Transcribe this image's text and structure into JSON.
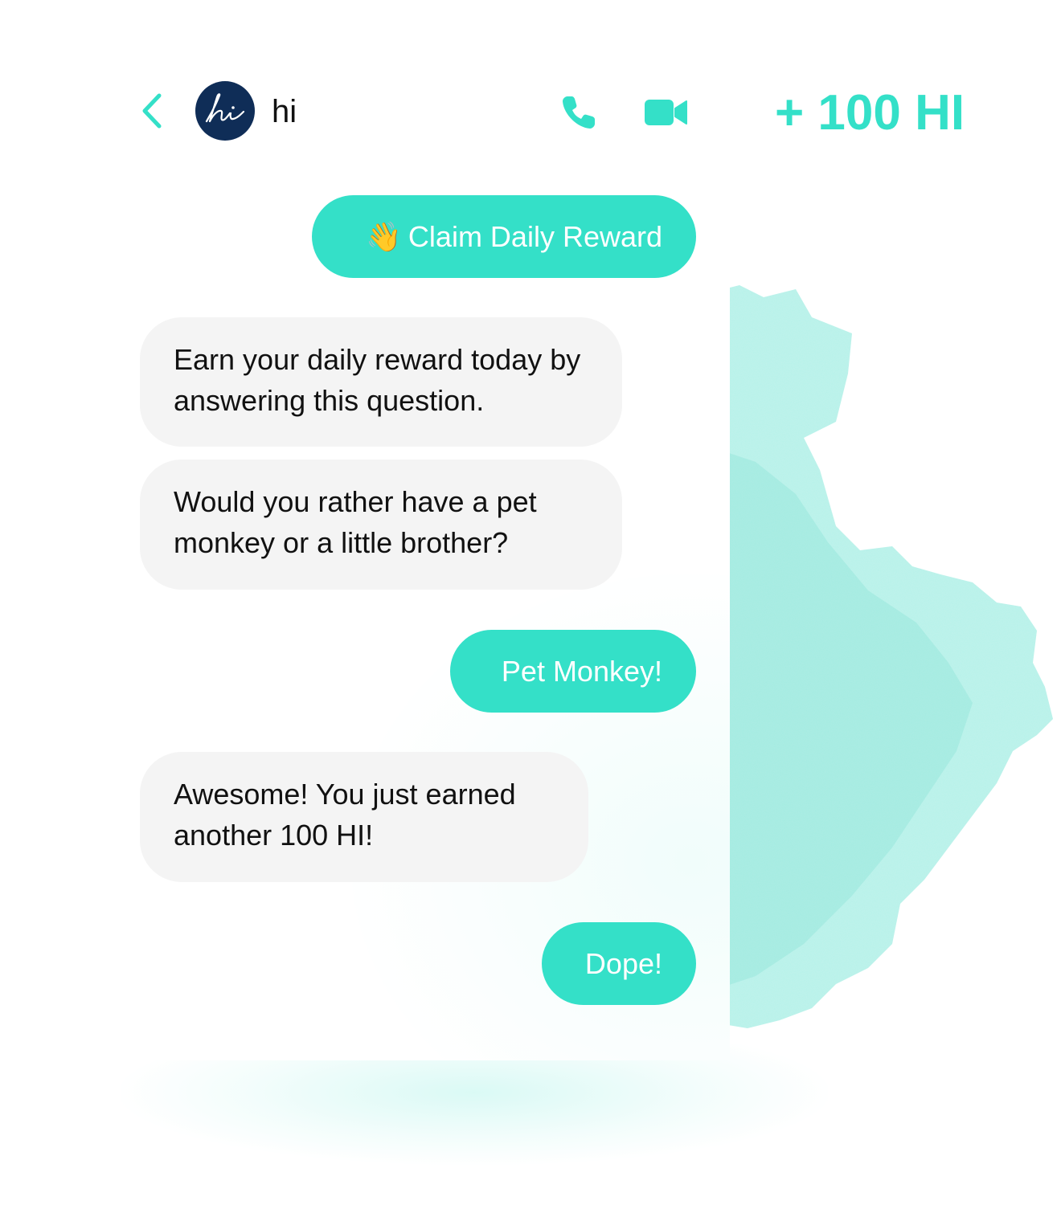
{
  "header": {
    "back_icon": "chevron-left-icon",
    "avatar_icon": "hi-script-logo-icon",
    "contact_name": "hi",
    "call_icon": "phone-icon",
    "video_icon": "video-camera-icon"
  },
  "reward_badge": "+ 100 HI",
  "messages": [
    {
      "from": "me",
      "emoji": "👋",
      "text": "Claim Daily Reward"
    },
    {
      "from": "them",
      "text": "Earn your daily reward today by answering this question."
    },
    {
      "from": "them",
      "text": "Would you rather have a pet monkey or a little brother?"
    },
    {
      "from": "me",
      "text": "Pet Monkey!"
    },
    {
      "from": "them",
      "text": "Awesome! You just earned another 100 HI!"
    },
    {
      "from": "me",
      "text": "Dope!"
    }
  ],
  "colors": {
    "accent": "#34e0c8",
    "incoming_bubble": "#f4f4f4",
    "avatar_bg": "#0f2d57",
    "text": "#111111"
  }
}
